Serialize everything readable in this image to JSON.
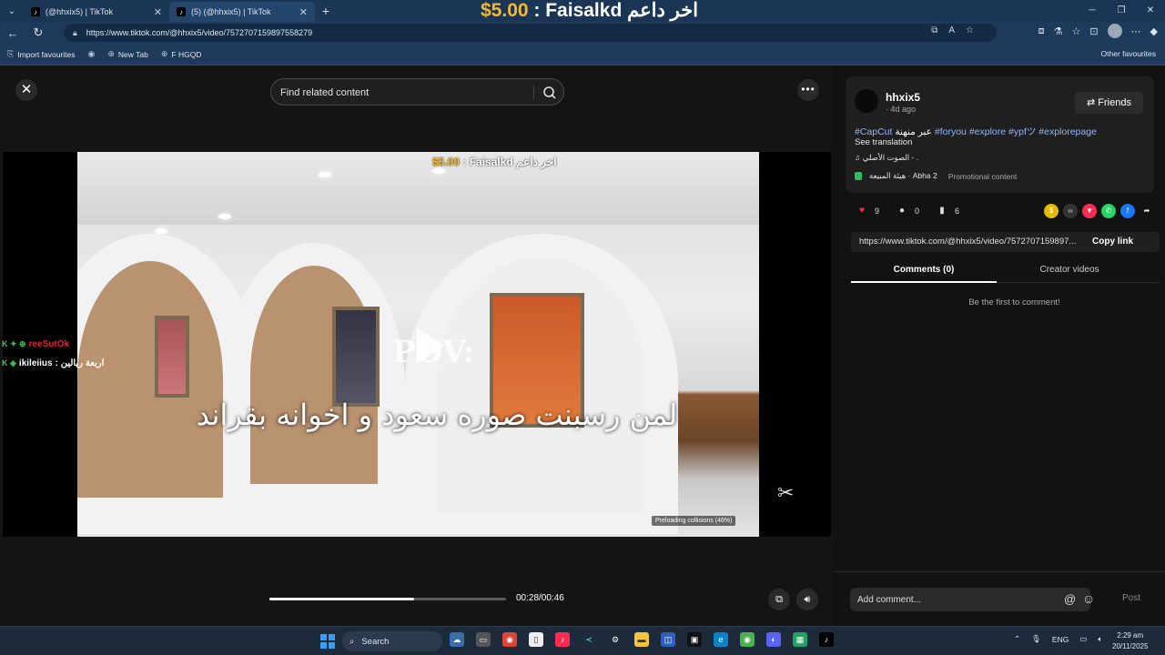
{
  "browser": {
    "tabs": [
      {
        "title": "(@hhxix5) | TikTok",
        "icon": "tiktok-icon"
      },
      {
        "title": "(5) (@hhxix5) | TikTok",
        "icon": "tiktok-icon"
      }
    ],
    "new_tab": "+",
    "url": "https://www.tiktok.com/@hhxix5/video/7572707159897558279",
    "bookmarks": [
      "Import favourites",
      "New Tab",
      "F HGQD"
    ],
    "other_favourites": "Other favourites"
  },
  "stream_overlay": {
    "amount": "$5.00",
    "separator": " : Faisalkd ",
    "label": "اخر داعم"
  },
  "video": {
    "search_placeholder": "Find related content",
    "pov_text": "POV:",
    "caption_ar": "لمن رسبنت صوره سعود و اخوانه بقراند",
    "preloading": "Preloading collisions (46%)",
    "time": "00:28/00:46",
    "progress": 0.61
  },
  "chat": [
    {
      "user": "reeSutOk",
      "msg": "",
      "user_color": "#e0213a"
    },
    {
      "user": "ikileiius",
      "msg": ": اربعة ريالين",
      "user_color": "#ffffff"
    }
  ],
  "sidebar": {
    "author": "hhxix5",
    "meta": "· 4d ago",
    "friends": "Friends",
    "desc_parts": [
      {
        "text": "#CapCut",
        "hash": true
      },
      {
        "text": " عبر منهنة ",
        "hash": false
      },
      {
        "text": "#foryou #explore #ypfツ #explorepage",
        "hash": true
      }
    ],
    "see_translation": "See translation",
    "sound": "♫ الصوت الأصلي - .",
    "location": "هيئة المبيعة · Abha 2",
    "promo": "Promotional content",
    "likes": "9",
    "comments": "0",
    "saves": "6",
    "link": "https://www.tiktok.com/@hhxix5/video/7572707159897...",
    "copy_link": "Copy link",
    "tab_comments": "Comments (0)",
    "tab_creator": "Creator videos",
    "empty": "Be the first to comment!",
    "comment_placeholder": "Add comment...",
    "post": "Post"
  },
  "taskbar": {
    "search": "Search",
    "lang": "ENG",
    "time": "2:29 am",
    "date": "20/11/2025"
  }
}
